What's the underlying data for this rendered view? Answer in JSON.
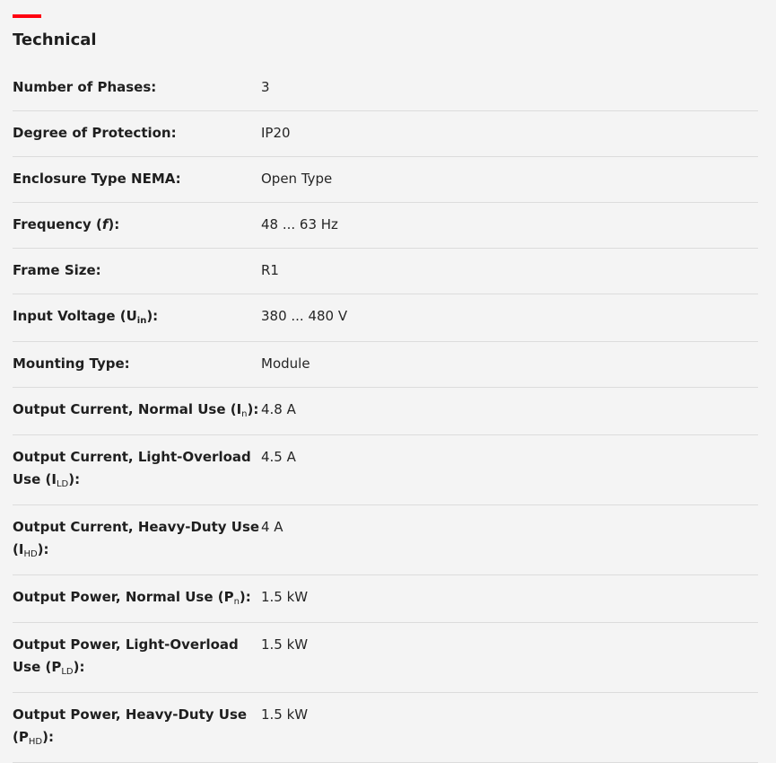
{
  "section": {
    "title": "Technical",
    "accent_color": "#ff000f"
  },
  "rows": [
    {
      "label": "Number of Phases:",
      "value": "3"
    },
    {
      "label": "Degree of Protection:",
      "value": "IP20"
    },
    {
      "label": "Enclosure Type NEMA:",
      "value": "Open Type"
    },
    {
      "label_pre": "Frequency (",
      "label_italic": "f",
      "label_post": "):",
      "value": "48 ... 63 Hz"
    },
    {
      "label": "Frame Size:",
      "value": "R1"
    },
    {
      "label_pre": "Input Voltage (U",
      "label_sub": "in",
      "label_post": "):",
      "value": "380 ... 480 V"
    },
    {
      "label": "Mounting Type:",
      "value": "Module"
    },
    {
      "label_pre": "Output Current, Normal Use (I",
      "label_sub": "n",
      "label_post": "):",
      "value": "4.8 A"
    },
    {
      "label_pre": "Output Current, Light-Overload Use (I",
      "label_sub": "LD",
      "label_post": "):",
      "value": "4.5 A"
    },
    {
      "label_pre": "Output Current, Heavy-Duty Use (I",
      "label_sub": "HD",
      "label_post": "):",
      "value": "4 A"
    },
    {
      "label_pre": "Output Power, Normal Use (P",
      "label_sub": "n",
      "label_post": "):",
      "value": "1.5 kW"
    },
    {
      "label_pre": "Output Power, Light-Overload Use (P",
      "label_sub": "LD",
      "label_post": "):",
      "value": "1.5 kW"
    },
    {
      "label_pre": "Output Power, Heavy-Duty Use (P",
      "label_sub": "HD",
      "label_post": "):",
      "value": "1.5 kW"
    }
  ]
}
